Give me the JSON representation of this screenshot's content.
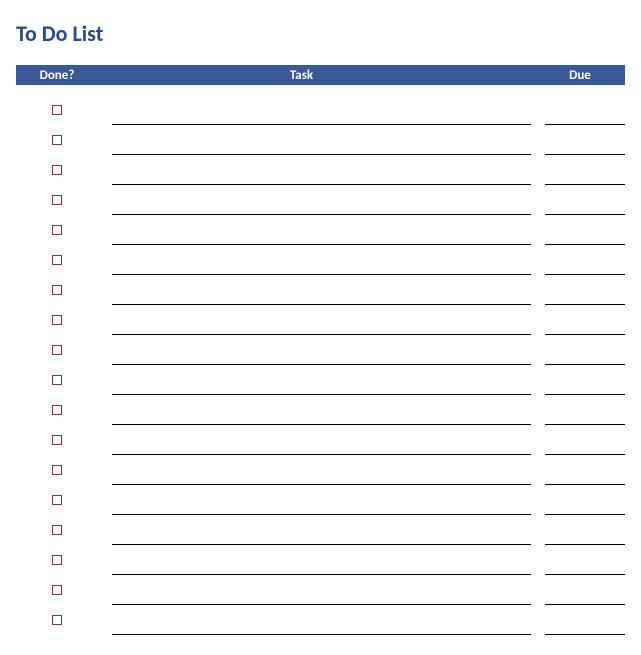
{
  "title": "To Do List",
  "headers": {
    "done": "Done?",
    "task": "Task",
    "due": "Due"
  },
  "row_count": 18
}
